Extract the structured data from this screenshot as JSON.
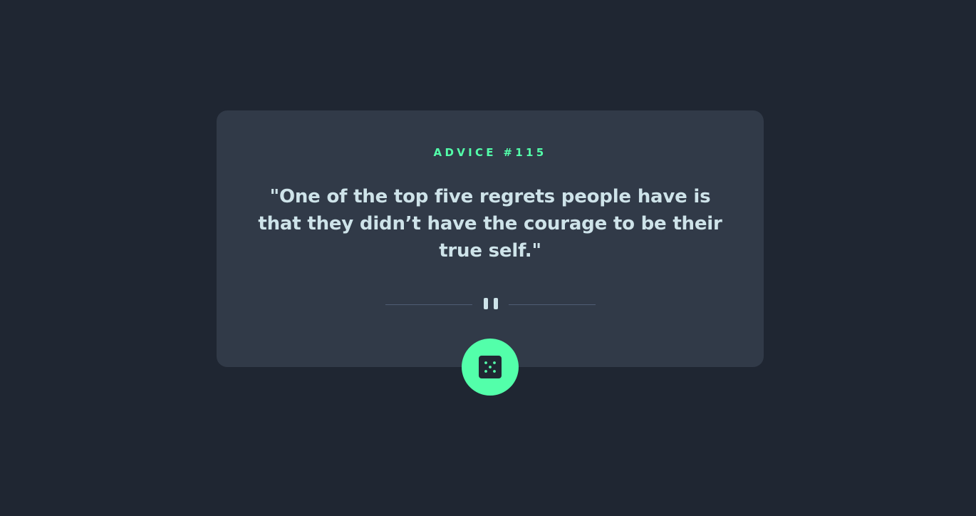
{
  "advice": {
    "label": "ADVICE #115",
    "quote": "\"One of the top five regrets people have is that they didn’t have the courage to be their true self.\""
  },
  "divider": {
    "icon": "pause-icon"
  },
  "dice_button": {
    "icon": "dice-icon"
  },
  "colors": {
    "background": "#1f2632",
    "card": "#313a48",
    "accent": "#53ffaa",
    "text": "#cee3e9",
    "divider": "#4f5d74"
  }
}
